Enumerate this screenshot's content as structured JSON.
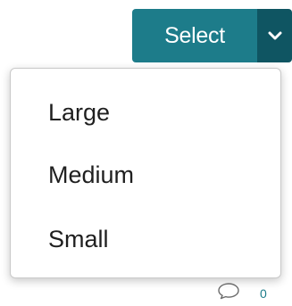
{
  "split_button": {
    "label": "Select",
    "toggle_icon": "chevron-down-icon",
    "colors": {
      "primary": "#1d7c8a",
      "toggle": "#0f5562",
      "text": "#ffffff"
    }
  },
  "menu": {
    "items": [
      {
        "label": "Large"
      },
      {
        "label": "Medium"
      },
      {
        "label": "Small"
      }
    ]
  },
  "comments": {
    "icon": "comment-icon",
    "count": "0",
    "count_color": "#1d7c8a"
  }
}
